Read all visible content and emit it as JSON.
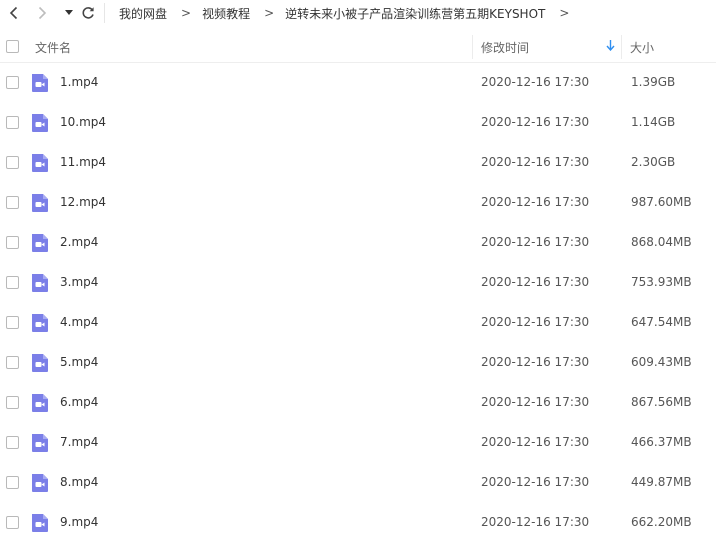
{
  "breadcrumb": {
    "items": [
      "我的网盘",
      "视频教程",
      "逆转未来小被子产品渲染训练营第五期KEYSHOT"
    ],
    "separator": ">"
  },
  "columns": {
    "name": "文件名",
    "modified": "修改时间",
    "size": "大小"
  },
  "colors": {
    "video_icon": "#7b7fe8",
    "sort_arrow": "#2f8ff0"
  },
  "files": [
    {
      "name": "1.mp4",
      "modified": "2020-12-16 17:30",
      "size": "1.39GB"
    },
    {
      "name": "10.mp4",
      "modified": "2020-12-16 17:30",
      "size": "1.14GB"
    },
    {
      "name": "11.mp4",
      "modified": "2020-12-16 17:30",
      "size": "2.30GB"
    },
    {
      "name": "12.mp4",
      "modified": "2020-12-16 17:30",
      "size": "987.60MB"
    },
    {
      "name": "2.mp4",
      "modified": "2020-12-16 17:30",
      "size": "868.04MB"
    },
    {
      "name": "3.mp4",
      "modified": "2020-12-16 17:30",
      "size": "753.93MB"
    },
    {
      "name": "4.mp4",
      "modified": "2020-12-16 17:30",
      "size": "647.54MB"
    },
    {
      "name": "5.mp4",
      "modified": "2020-12-16 17:30",
      "size": "609.43MB"
    },
    {
      "name": "6.mp4",
      "modified": "2020-12-16 17:30",
      "size": "867.56MB"
    },
    {
      "name": "7.mp4",
      "modified": "2020-12-16 17:30",
      "size": "466.37MB"
    },
    {
      "name": "8.mp4",
      "modified": "2020-12-16 17:30",
      "size": "449.87MB"
    },
    {
      "name": "9.mp4",
      "modified": "2020-12-16 17:30",
      "size": "662.20MB"
    }
  ]
}
